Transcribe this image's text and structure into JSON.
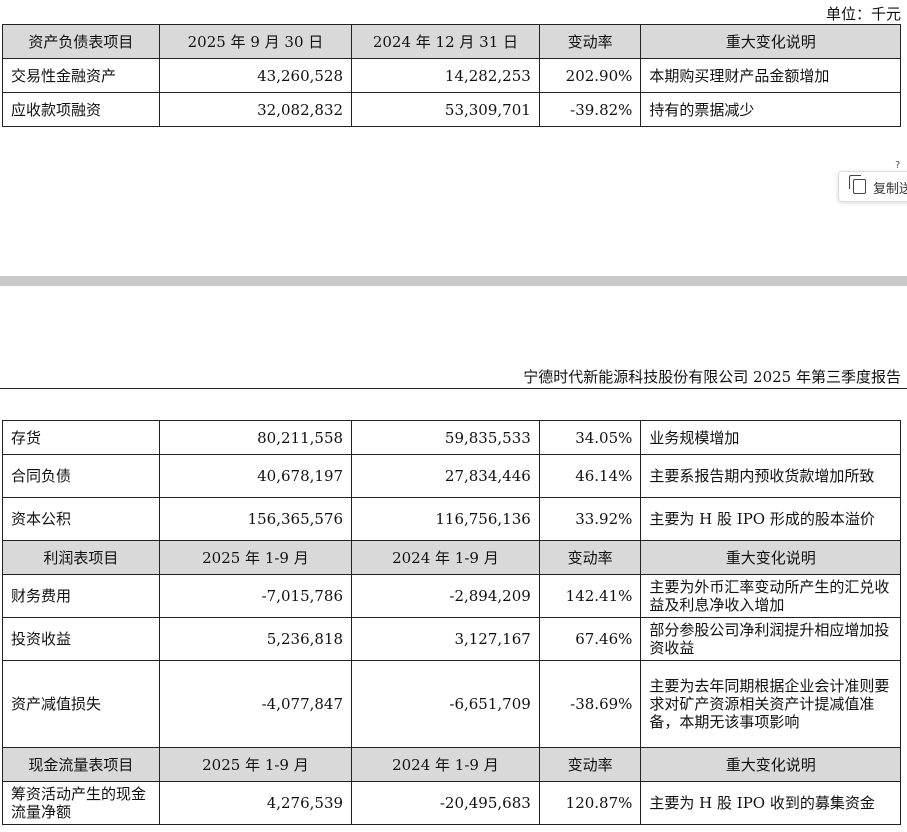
{
  "unit_label": "单位：千元",
  "report_header": "宁德时代新能源科技股份有限公司 2025 年第三季度报告",
  "copy_button": {
    "label": "复制送"
  },
  "tiny_mark": "?",
  "table1": {
    "header": [
      "资产负债表项目",
      "2025 年 9 月 30 日",
      "2024 年 12 月 31 日",
      "变动率",
      "重大变化说明"
    ],
    "rows": [
      [
        "交易性金融资产",
        "43,260,528",
        "14,282,253",
        "202.90%",
        "本期购买理财产品金额增加"
      ],
      [
        "应收款项融资",
        "32,082,832",
        "53,309,701",
        "-39.82%",
        "持有的票据减少"
      ]
    ]
  },
  "table2": {
    "rows_a": [
      [
        "存货",
        "80,211,558",
        "59,835,533",
        "34.05%",
        "业务规模增加"
      ],
      [
        "合同负债",
        "40,678,197",
        "27,834,446",
        "46.14%",
        "主要系报告期内预收货款增加所致"
      ],
      [
        "资本公积",
        "156,365,576",
        "116,756,136",
        "33.92%",
        "主要为 H 股 IPO 形成的股本溢价"
      ]
    ],
    "header_b": [
      "利润表项目",
      "2025 年 1-9 月",
      "2024 年 1-9 月",
      "变动率",
      "重大变化说明"
    ],
    "rows_b": [
      [
        "财务费用",
        "-7,015,786",
        "-2,894,209",
        "142.41%",
        "主要为外币汇率变动所产生的汇兑收益及利息净收入增加"
      ],
      [
        "投资收益",
        "5,236,818",
        "3,127,167",
        "67.46%",
        "部分参股公司净利润提升相应增加投资收益"
      ],
      [
        "资产减值损失",
        "-4,077,847",
        "-6,651,709",
        "-38.69%",
        "主要为去年同期根据企业会计准则要求对矿产资源相关资产计提减值准备，本期无该事项影响"
      ]
    ],
    "header_c": [
      "现金流量表项目",
      "2025 年 1-9 月",
      "2024 年 1-9 月",
      "变动率",
      "重大变化说明"
    ],
    "rows_c": [
      [
        "筹资活动产生的现金流量净额",
        "4,276,539",
        "-20,495,683",
        "120.87%",
        "主要为 H 股 IPO 收到的募集资金"
      ]
    ]
  }
}
